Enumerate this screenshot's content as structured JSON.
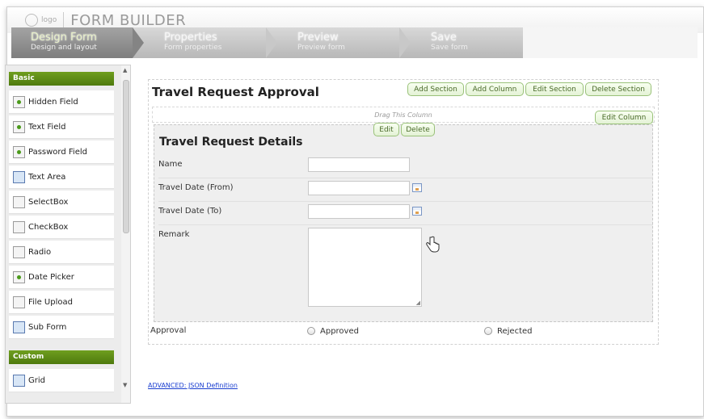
{
  "app": {
    "logo_text": "logo",
    "title": "FORM BUILDER"
  },
  "steps": [
    {
      "title": "Design Form",
      "subtitle": "Design and layout"
    },
    {
      "title": "Properties",
      "subtitle": "Form properties"
    },
    {
      "title": "Preview",
      "subtitle": "Preview form"
    },
    {
      "title": "Save",
      "subtitle": "Save form"
    }
  ],
  "palette": {
    "basic_label": "Basic",
    "basic_items": [
      {
        "label": "Hidden Field",
        "icon": "hidden-field-icon"
      },
      {
        "label": "Text Field",
        "icon": "text-field-icon"
      },
      {
        "label": "Password Field",
        "icon": "password-field-icon"
      },
      {
        "label": "Text Area",
        "icon": "text-area-icon"
      },
      {
        "label": "SelectBox",
        "icon": "select-box-icon"
      },
      {
        "label": "CheckBox",
        "icon": "checkbox-icon"
      },
      {
        "label": "Radio",
        "icon": "radio-icon"
      },
      {
        "label": "Date Picker",
        "icon": "date-picker-icon"
      },
      {
        "label": "File Upload",
        "icon": "file-upload-icon"
      },
      {
        "label": "Sub Form",
        "icon": "sub-form-icon"
      }
    ],
    "custom_label": "Custom",
    "custom_items": [
      {
        "label": "Grid",
        "icon": "grid-icon"
      }
    ]
  },
  "form": {
    "title": "Travel Request Approval",
    "buttons": {
      "add_section": "Add Section",
      "add_column": "Add Column",
      "edit_section": "Edit Section",
      "delete_section": "Delete Section",
      "edit_column": "Edit Column",
      "edit": "Edit",
      "delete": "Delete"
    },
    "drag_hint": "Drag This Column",
    "section_title": "Travel Request Details",
    "fields": {
      "name": "Name",
      "travel_from": "Travel Date (From)",
      "travel_to": "Travel Date (To)",
      "remark": "Remark"
    },
    "approval": {
      "label": "Approval",
      "option_approved": "Approved",
      "option_rejected": "Rejected"
    }
  },
  "advanced_link": "ADVANCED: JSON Definition",
  "colors": {
    "accent_green": "#5e8c16",
    "link": "#1a3ed0"
  }
}
